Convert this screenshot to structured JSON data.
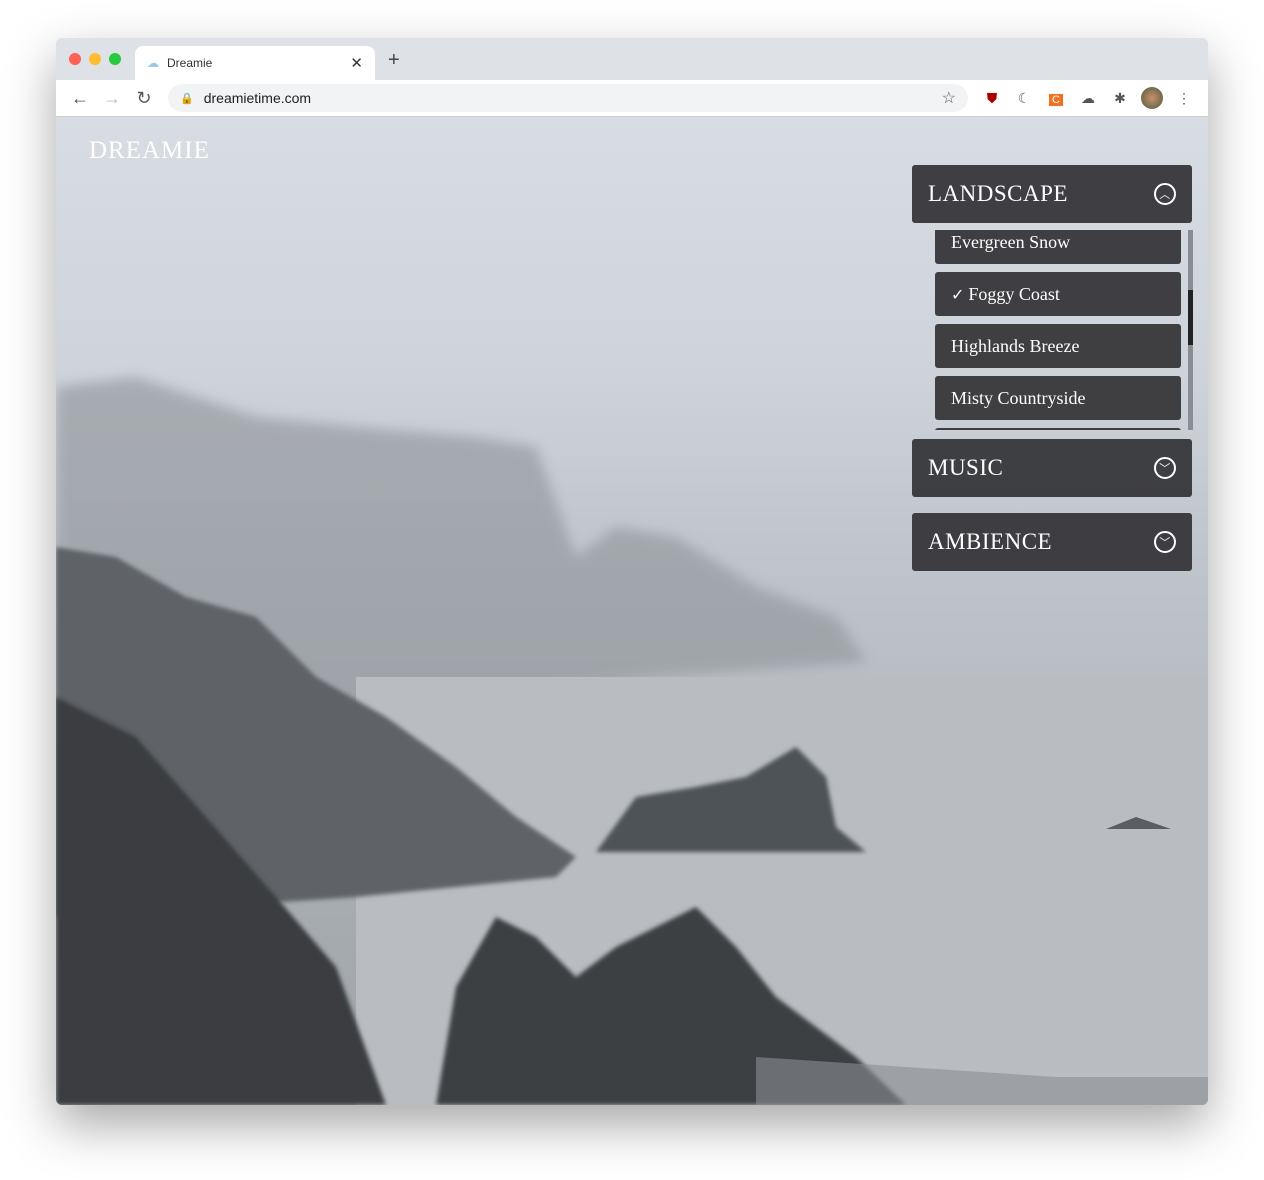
{
  "browser": {
    "tab_title": "Dreamie",
    "url": "dreamietime.com",
    "colors": {
      "close": "#fe5f57",
      "minimize": "#febc2e",
      "zoom": "#28c840"
    },
    "extensions": [
      "ublock-icon",
      "moon-icon",
      "c-extension-icon",
      "cloud-icon",
      "puzzle-icon",
      "profile-avatar",
      "menu-icon"
    ]
  },
  "page": {
    "logo": "DREAMIE",
    "sections": [
      {
        "label": "LANDSCAPE",
        "expanded": true
      },
      {
        "label": "MUSIC",
        "expanded": false
      },
      {
        "label": "AMBIENCE",
        "expanded": false
      }
    ],
    "landscape_items": [
      {
        "label": "Evergreen Snow",
        "selected": false
      },
      {
        "label": "Foggy Coast",
        "selected": true
      },
      {
        "label": "Highlands Breeze",
        "selected": false
      },
      {
        "label": "Misty Countryside",
        "selected": false
      }
    ],
    "check": "✓"
  }
}
